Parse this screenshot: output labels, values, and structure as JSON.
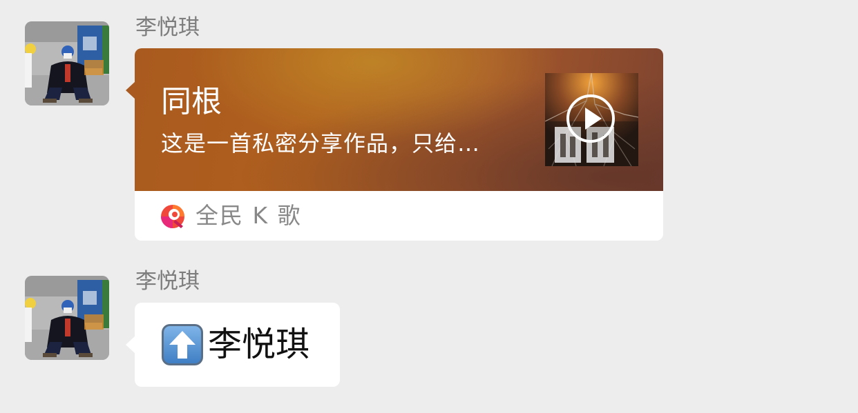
{
  "messages": [
    {
      "sender": "李悦琪",
      "type": "music-card",
      "card": {
        "title": "同根",
        "description": "这是一首私密分享作品，只给…",
        "app_name": "全民 K 歌",
        "cover_icon": "play-icon",
        "app_icon": "quanmin-kge-logo"
      }
    },
    {
      "sender": "李悦琪",
      "type": "text",
      "emoji": "up-arrow-emoji",
      "text": "李悦琪"
    }
  ],
  "colors": {
    "chat_background": "#ededed",
    "bubble_background": "#ffffff",
    "card_gradient_start": "#a95a1e",
    "card_gradient_end": "#7d4330",
    "sender_name": "#7d7d7d"
  }
}
